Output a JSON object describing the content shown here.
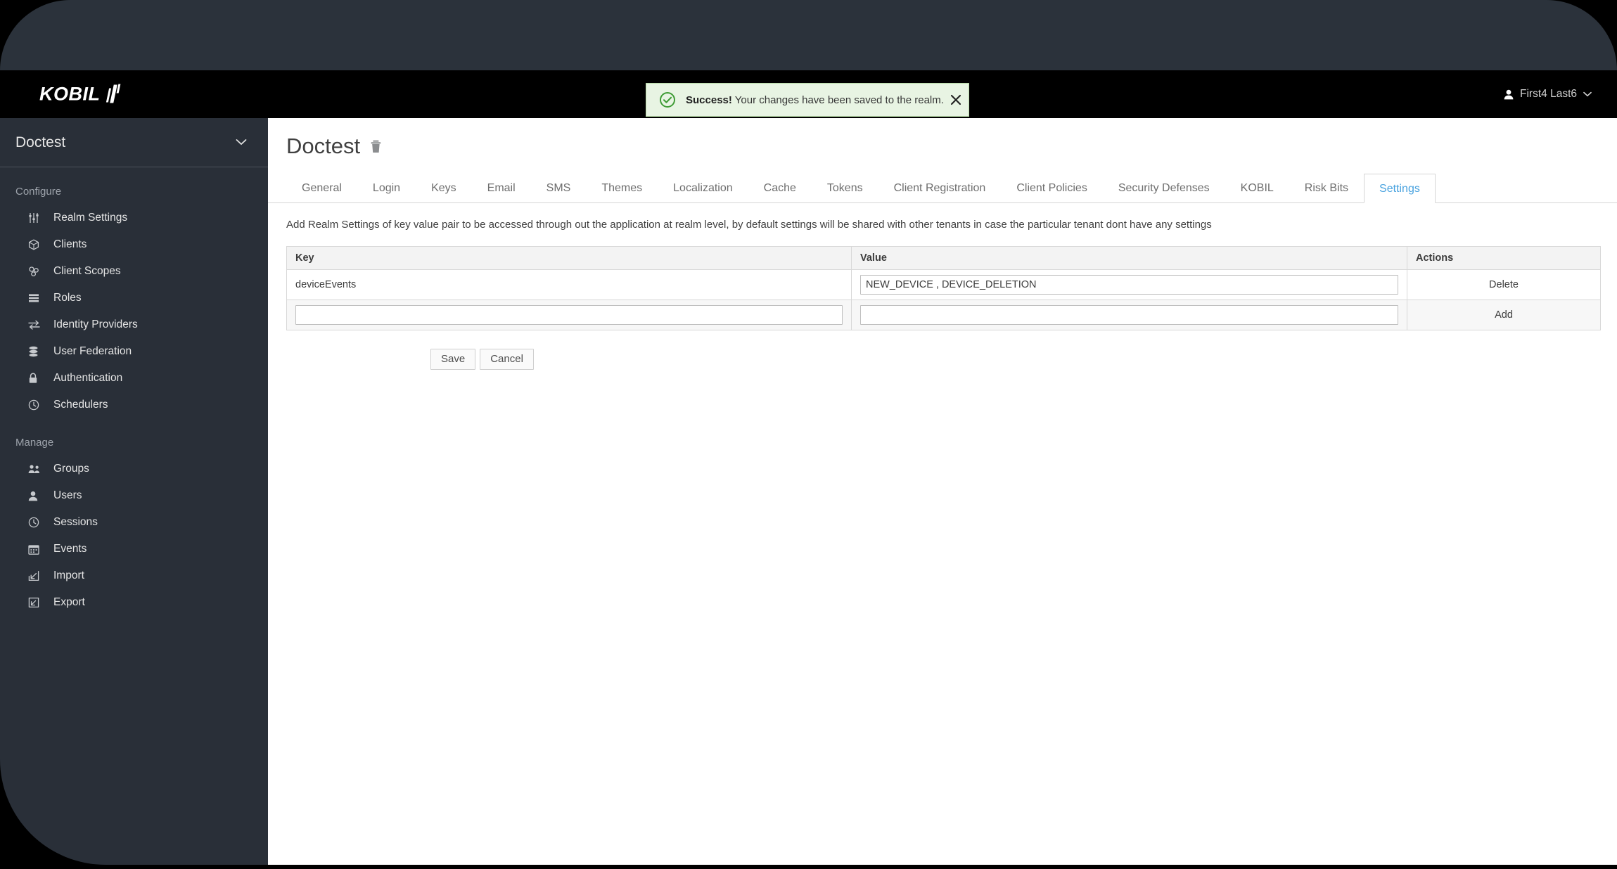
{
  "header": {
    "brand": "KOBIL",
    "user": {
      "name": "First4 Last6",
      "avatar_icon": "user-icon",
      "caret_icon": "chevron-down-icon"
    }
  },
  "alert": {
    "icon": "check-circle-icon",
    "strong": "Success!",
    "message": " Your changes have been saved to the realm.",
    "close_icon": "close-icon",
    "bg_color": "#e8f4e3",
    "border_color": "#b9dca8",
    "accent_color": "#3f9c35"
  },
  "sidebar": {
    "realm_selector": {
      "name": "Doctest",
      "caret_icon": "chevron-down-icon"
    },
    "sections": [
      {
        "label": "Configure",
        "items": [
          {
            "label": "Realm Settings",
            "icon": "sliders-icon"
          },
          {
            "label": "Clients",
            "icon": "cube-icon"
          },
          {
            "label": "Client Scopes",
            "icon": "cubes-icon"
          },
          {
            "label": "Roles",
            "icon": "list-bars-icon"
          },
          {
            "label": "Identity Providers",
            "icon": "exchange-arrows-icon"
          },
          {
            "label": "User Federation",
            "icon": "database-icon"
          },
          {
            "label": "Authentication",
            "icon": "lock-icon"
          },
          {
            "label": "Schedulers",
            "icon": "clock-icon"
          }
        ]
      },
      {
        "label": "Manage",
        "items": [
          {
            "label": "Groups",
            "icon": "users-group-icon"
          },
          {
            "label": "Users",
            "icon": "user-icon"
          },
          {
            "label": "Sessions",
            "icon": "clock-icon"
          },
          {
            "label": "Events",
            "icon": "calendar-icon"
          },
          {
            "label": "Import",
            "icon": "import-arrow-icon"
          },
          {
            "label": "Export",
            "icon": "export-arrow-icon"
          }
        ]
      }
    ]
  },
  "main": {
    "page_title": "Doctest",
    "delete_icon": "trash-icon",
    "tabs": [
      {
        "label": "General",
        "active": false
      },
      {
        "label": "Login",
        "active": false
      },
      {
        "label": "Keys",
        "active": false
      },
      {
        "label": "Email",
        "active": false
      },
      {
        "label": "SMS",
        "active": false
      },
      {
        "label": "Themes",
        "active": false
      },
      {
        "label": "Localization",
        "active": false
      },
      {
        "label": "Cache",
        "active": false
      },
      {
        "label": "Tokens",
        "active": false
      },
      {
        "label": "Client Registration",
        "active": false
      },
      {
        "label": "Client Policies",
        "active": false
      },
      {
        "label": "Security Defenses",
        "active": false
      },
      {
        "label": "KOBIL",
        "active": false
      },
      {
        "label": "Risk Bits",
        "active": false
      },
      {
        "label": "Settings",
        "active": true
      }
    ],
    "active_tab_color": "#4aa3df",
    "description": "Add Realm Settings of key value pair to be accessed through out the application at realm level, by default settings will be shared with other tenants in case the particular tenant dont have any settings",
    "table": {
      "columns": [
        "Key",
        "Value",
        "Actions"
      ],
      "rows": [
        {
          "key": "deviceEvents",
          "key_editable": false,
          "value": "NEW_DEVICE , DEVICE_DELETION",
          "value_editable": true,
          "action": "Delete"
        },
        {
          "key": "",
          "key_editable": true,
          "key_placeholder": "",
          "value": "",
          "value_editable": true,
          "value_placeholder": "",
          "action": "Add"
        }
      ]
    },
    "buttons": {
      "save": "Save",
      "cancel": "Cancel"
    }
  }
}
